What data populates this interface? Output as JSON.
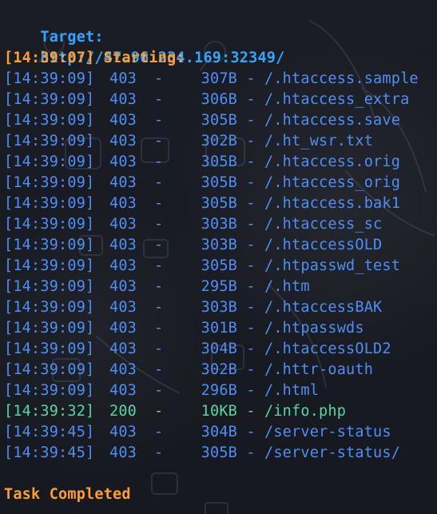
{
  "header": {
    "target_label": "Target:",
    "target_url": "http://47.96.234.169:32349/"
  },
  "status": {
    "starting": "[14:39:07] Starting:",
    "completed": "Task Completed"
  },
  "results": [
    {
      "time": "[14:39:09]",
      "status": "403",
      "dash1": "-",
      "size": "307B",
      "dash2": "-",
      "path": "/.htaccess.sample"
    },
    {
      "time": "[14:39:09]",
      "status": "403",
      "dash1": "-",
      "size": "306B",
      "dash2": "-",
      "path": "/.htaccess_extra"
    },
    {
      "time": "[14:39:09]",
      "status": "403",
      "dash1": "-",
      "size": "305B",
      "dash2": "-",
      "path": "/.htaccess.save"
    },
    {
      "time": "[14:39:09]",
      "status": "403",
      "dash1": "-",
      "size": "302B",
      "dash2": "-",
      "path": "/.ht_wsr.txt"
    },
    {
      "time": "[14:39:09]",
      "status": "403",
      "dash1": "-",
      "size": "305B",
      "dash2": "-",
      "path": "/.htaccess.orig"
    },
    {
      "time": "[14:39:09]",
      "status": "403",
      "dash1": "-",
      "size": "305B",
      "dash2": "-",
      "path": "/.htaccess_orig"
    },
    {
      "time": "[14:39:09]",
      "status": "403",
      "dash1": "-",
      "size": "305B",
      "dash2": "-",
      "path": "/.htaccess.bak1"
    },
    {
      "time": "[14:39:09]",
      "status": "403",
      "dash1": "-",
      "size": "303B",
      "dash2": "-",
      "path": "/.htaccess_sc"
    },
    {
      "time": "[14:39:09]",
      "status": "403",
      "dash1": "-",
      "size": "303B",
      "dash2": "-",
      "path": "/.htaccessOLD"
    },
    {
      "time": "[14:39:09]",
      "status": "403",
      "dash1": "-",
      "size": "305B",
      "dash2": "-",
      "path": "/.htpasswd_test"
    },
    {
      "time": "[14:39:09]",
      "status": "403",
      "dash1": "-",
      "size": "295B",
      "dash2": "-",
      "path": "/.htm"
    },
    {
      "time": "[14:39:09]",
      "status": "403",
      "dash1": "-",
      "size": "303B",
      "dash2": "-",
      "path": "/.htaccessBAK"
    },
    {
      "time": "[14:39:09]",
      "status": "403",
      "dash1": "-",
      "size": "301B",
      "dash2": "-",
      "path": "/.htpasswds"
    },
    {
      "time": "[14:39:09]",
      "status": "403",
      "dash1": "-",
      "size": "304B",
      "dash2": "-",
      "path": "/.htaccessOLD2"
    },
    {
      "time": "[14:39:09]",
      "status": "403",
      "dash1": "-",
      "size": "302B",
      "dash2": "-",
      "path": "/.httr-oauth"
    },
    {
      "time": "[14:39:09]",
      "status": "403",
      "dash1": "-",
      "size": "296B",
      "dash2": "-",
      "path": "/.html"
    },
    {
      "time": "[14:39:32]",
      "status": "200",
      "dash1": "-",
      "size": "10KB",
      "dash2": "-",
      "path": "/info.php"
    },
    {
      "time": "[14:39:45]",
      "status": "403",
      "dash1": "-",
      "size": "304B",
      "dash2": "-",
      "path": "/server-status"
    },
    {
      "time": "[14:39:45]",
      "status": "403",
      "dash1": "-",
      "size": "305B",
      "dash2": "-",
      "path": "/server-status/"
    }
  ],
  "colors": {
    "background": "#17191f",
    "accent_blue": "#34a5ff",
    "accent_orange": "#ff9d2e",
    "row_blue": "#4f8ef7",
    "success_green": "#58d6a4"
  }
}
